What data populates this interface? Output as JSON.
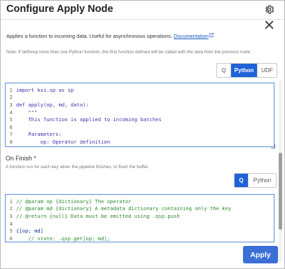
{
  "dialog": {
    "title": "Configure Apply Node",
    "description": "Applies a function to incoming data. Useful for asynchronous operations.",
    "documentation_link": "Documentation",
    "note": "Note: If defining more than one Python function, the first function defined will be called with the data from the previous node."
  },
  "language_toggle_1": {
    "options": [
      "Q",
      "Python",
      "UDF"
    ],
    "selected": "Python"
  },
  "editor_1": {
    "lines": [
      {
        "num": "1",
        "text": "import kxi.sp as sp"
      },
      {
        "num": "2",
        "text": ""
      },
      {
        "num": "3",
        "text": "def apply(op, md, data):"
      },
      {
        "num": "4",
        "text": "    \"\"\""
      },
      {
        "num": "5",
        "text": "    This function is applied to incoming batches"
      },
      {
        "num": "6",
        "text": ""
      },
      {
        "num": "7",
        "text": "    Parameters:"
      },
      {
        "num": "8",
        "text": "        op: Operator definition"
      }
    ]
  },
  "on_finish": {
    "title": "On Finish *",
    "description": "A function run for each key when the pipeline finishes, to flush the buffer."
  },
  "language_toggle_2": {
    "options": [
      "Q",
      "Python"
    ],
    "selected": "Q"
  },
  "editor_2": {
    "lines": [
      {
        "num": "1",
        "text": "// @param op {dictionary} The operator"
      },
      {
        "num": "2",
        "text": "// @param md {dictionary} A metadata dictionary containing only the key"
      },
      {
        "num": "3",
        "text": "// @return {null} Data must be emitted using .qsp.push"
      },
      {
        "num": "4",
        "text": ""
      },
      {
        "num": "5",
        "text": "{[op; md]"
      },
      {
        "num": "6",
        "text": "    // state: .qsp.get[op; md];"
      }
    ]
  },
  "footer": {
    "apply_label": "Apply"
  },
  "colors": {
    "accent": "#1f63d8",
    "apply_button": "#3b6fd6",
    "code_keyword": "#4a2bad",
    "code_comment": "#2b8a2b",
    "link": "#1a57c4"
  },
  "icons": {
    "settings": "gear-icon",
    "close": "close-icon",
    "external_link": "external-link-icon"
  }
}
